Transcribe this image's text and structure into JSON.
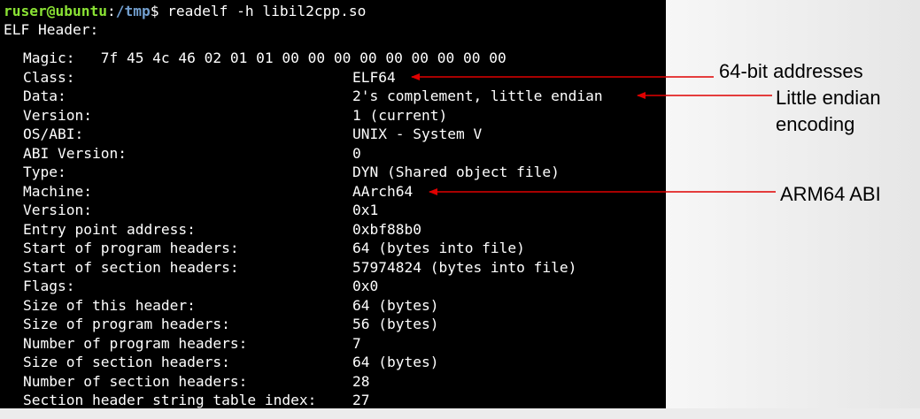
{
  "terminal": {
    "prompt_user": "ruser@ubuntu",
    "prompt_sep": ":",
    "prompt_path": "/tmp",
    "prompt_dollar": "$",
    "command": " readelf -h libil2cpp.so",
    "header_title": "ELF Header:",
    "fields": [
      {
        "label": "Magic:   7f 45 4c 46 02 01 01 00 00 00 00 00 00 00 00 00",
        "value": ""
      },
      {
        "label": "Class:",
        "value": "ELF64"
      },
      {
        "label": "Data:",
        "value": "2's complement, little endian"
      },
      {
        "label": "Version:",
        "value": "1 (current)"
      },
      {
        "label": "OS/ABI:",
        "value": "UNIX - System V"
      },
      {
        "label": "ABI Version:",
        "value": "0"
      },
      {
        "label": "Type:",
        "value": "DYN (Shared object file)"
      },
      {
        "label": "Machine:",
        "value": "AArch64"
      },
      {
        "label": "Version:",
        "value": "0x1"
      },
      {
        "label": "Entry point address:",
        "value": "0xbf88b0"
      },
      {
        "label": "Start of program headers:",
        "value": "64 (bytes into file)"
      },
      {
        "label": "Start of section headers:",
        "value": "57974824 (bytes into file)"
      },
      {
        "label": "Flags:",
        "value": "0x0"
      },
      {
        "label": "Size of this header:",
        "value": "64 (bytes)"
      },
      {
        "label": "Size of program headers:",
        "value": "56 (bytes)"
      },
      {
        "label": "Number of program headers:",
        "value": "7"
      },
      {
        "label": "Size of section headers:",
        "value": "64 (bytes)"
      },
      {
        "label": "Number of section headers:",
        "value": "28"
      },
      {
        "label": "Section header string table index:",
        "value": "27"
      }
    ]
  },
  "annotations": {
    "addresses": "64-bit addresses",
    "endian_line1": "Little endian",
    "endian_line2": "encoding",
    "abi": "ARM64 ABI"
  },
  "colors": {
    "terminal_bg": "#000000",
    "terminal_text": "#ffffff",
    "prompt_user": "#8ae234",
    "prompt_path": "#729fcf",
    "arrow": "#e00000"
  }
}
